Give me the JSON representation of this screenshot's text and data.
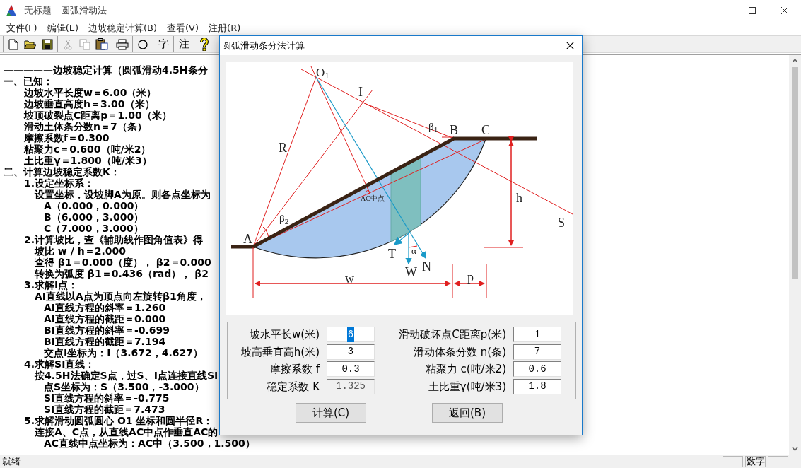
{
  "window": {
    "title": "无标题 - 圆弧滑动法"
  },
  "menu": [
    {
      "label": "文件(F)"
    },
    {
      "label": "编辑(E)"
    },
    {
      "label": "边坡稳定计算(B)"
    },
    {
      "label": "查看(V)"
    },
    {
      "label": "注册(R)"
    }
  ],
  "toolbar": {
    "groups": [
      [
        {
          "kind": "new",
          "disabled": false
        },
        {
          "kind": "open",
          "disabled": false
        },
        {
          "kind": "save",
          "disabled": false
        }
      ],
      [
        {
          "kind": "cut",
          "disabled": true
        },
        {
          "kind": "copy",
          "disabled": true
        },
        {
          "kind": "paste",
          "disabled": false
        }
      ],
      [
        {
          "kind": "print",
          "disabled": false
        }
      ],
      [
        {
          "kind": "circle",
          "disabled": false
        }
      ],
      [
        {
          "kind": "text",
          "label": "字",
          "disabled": false
        }
      ],
      [
        {
          "kind": "text",
          "label": "注",
          "disabled": false
        }
      ],
      [
        {
          "kind": "help",
          "disabled": false
        }
      ]
    ]
  },
  "document": {
    "lines": [
      {
        "text": "—————边坡稳定计算（圆弧滑动4.5H条分"
      },
      {
        "text": "一、已知：",
        "children": [
          {
            "text": "边坡水平长度w＝6.00（米）"
          },
          {
            "text": "边坡垂直高度h＝3.00（米）"
          },
          {
            "text": "坡顶破裂点C距离p＝1.00（米）"
          },
          {
            "text": "滑动土体条分数n＝7（条）"
          },
          {
            "text": "摩擦系数f＝0.300"
          },
          {
            "text": "粘聚力c＝0.600（吨/米2）"
          },
          {
            "text": "土比重γ＝1.800（吨/米3）"
          }
        ]
      },
      {
        "text": "二、计算边坡稳定系数K：",
        "children": [
          {
            "text": "1.设定坐标系：",
            "children": [
              {
                "text": "设置坐标，设坡脚A为原。则各点坐标为",
                "children": [
                  {
                    "text": "A（0.000，0.000）"
                  },
                  {
                    "text": "B（6.000，3.000）"
                  },
                  {
                    "text": "C（7.000，3.000）"
                  }
                ]
              }
            ]
          },
          {
            "text": "2.计算坡比，查《辅助线作图角值表》得",
            "children": [
              {
                "text": "坡比 w / h＝2.000"
              },
              {
                "text": "查得 β1＝0.000（度），  β2＝0.000"
              },
              {
                "text": "转换为弧度 β1＝0.436（rad），  β2"
              }
            ]
          },
          {
            "text": "3.求解I点：",
            "children": [
              {
                "text": "AI直线以A点为顶点向左旋转β1角度，",
                "children": [
                  {
                    "text": "AI直线方程的斜率＝1.260"
                  },
                  {
                    "text": "AI直线方程的截距＝0.000"
                  },
                  {
                    "text": "BI直线方程的斜率＝-0.699"
                  },
                  {
                    "text": "BI直线方程的截距＝7.194"
                  },
                  {
                    "text": "交点I坐标为：I（3.672，4.627）"
                  }
                ]
              }
            ]
          },
          {
            "text": "4.求解SI直线：",
            "children": [
              {
                "text": "按4.5H法确定S点，过S、I点连接直线SI",
                "children": [
                  {
                    "text": "点S坐标为：S（3.500，-3.000）"
                  },
                  {
                    "text": "SI直线方程的斜率＝-0.775"
                  },
                  {
                    "text": "SI直线方程的截距＝7.473"
                  }
                ]
              }
            ]
          },
          {
            "text": "5.求解滑动圆弧圆心 O1 坐标和圆半径R：",
            "children": [
              {
                "text": "连接A、C点，从直线AC中点作垂直AC的",
                "children": [
                  {
                    "text": "AC直线中点坐标为：AC中（3.500，1.500）"
                  }
                ]
              }
            ]
          }
        ]
      }
    ]
  },
  "dialog": {
    "title": "圆弧滑动条分法计算",
    "diagram": {
      "labels": [
        "O$_{1}$",
        "I",
        "R",
        "β$_{1}$",
        "B",
        "C",
        "S",
        "h",
        "β$_{2}$",
        "A",
        "AC中点",
        "T",
        "α",
        "W",
        "N",
        "w",
        "p"
      ]
    },
    "fields": [
      {
        "label": "坡水平长w(米)",
        "value": "6",
        "highlighted": true,
        "disabled": false
      },
      {
        "label": "滑动破坏点C距离p(米)",
        "value": "1",
        "highlighted": false,
        "disabled": false
      },
      {
        "label": "坡高垂直高h(米)",
        "value": "3",
        "highlighted": false,
        "disabled": false
      },
      {
        "label": "滑动体条分数 n(条)",
        "value": "7",
        "highlighted": false,
        "disabled": false
      },
      {
        "label": "摩擦系数 f",
        "value": "0.3",
        "highlighted": false,
        "disabled": false
      },
      {
        "label": "粘聚力 c(吨/米2)",
        "value": "0.6",
        "highlighted": false,
        "disabled": false
      },
      {
        "label": "稳定系数 K",
        "value": "1.325",
        "highlighted": false,
        "disabled": true
      },
      {
        "label": "土比重γ(吨/米3)",
        "value": "1.8",
        "highlighted": false,
        "disabled": false
      }
    ],
    "buttons": [
      {
        "label": "计算(C)"
      },
      {
        "label": "返回(B)"
      }
    ]
  },
  "status_bar": {
    "message": "就绪",
    "panels": [
      {
        "kind": "blank"
      },
      {
        "kind": "text",
        "text": "数字"
      },
      {
        "kind": "blank"
      }
    ]
  }
}
